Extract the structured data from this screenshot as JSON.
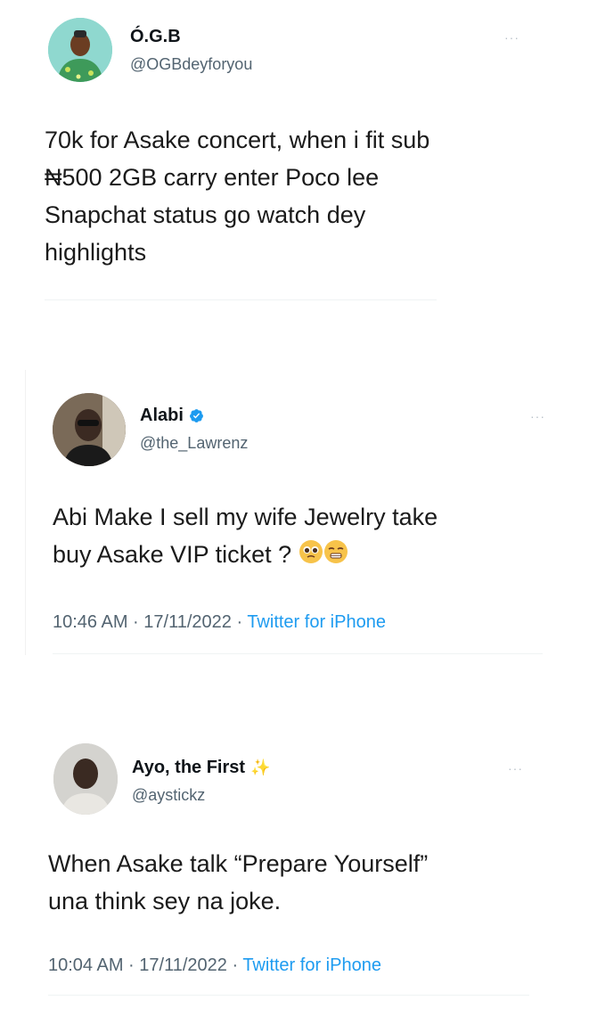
{
  "tweets": [
    {
      "name": "Ó.G.B",
      "handle": "@OGBdeyforyou",
      "text": "70k for Asake concert, when i fit sub\n₦500 2GB carry enter Poco lee\nSnapchat status go watch dey\nhighlights",
      "more": "···"
    },
    {
      "name": "Alabi",
      "handle": "@the_Lawrenz",
      "text": "Abi Make I sell my wife Jewelry take\nbuy Asake VIP ticket ?",
      "time": "10:46 AM · 17/11/2022 · ",
      "source": "Twitter for iPhone",
      "more": "···"
    },
    {
      "name": "Ayo, the First",
      "handle": "@aystickz",
      "text": "When Asake talk “Prepare Yourself”\nuna think sey na joke.",
      "time": "10:04 AM · 17/11/2022 · ",
      "source": "Twitter for iPhone",
      "more": "···"
    }
  ],
  "colors": {
    "text": "#0f1419",
    "secondary": "#536471",
    "link": "#1d9bf0",
    "verified": "#1d9bf0"
  }
}
